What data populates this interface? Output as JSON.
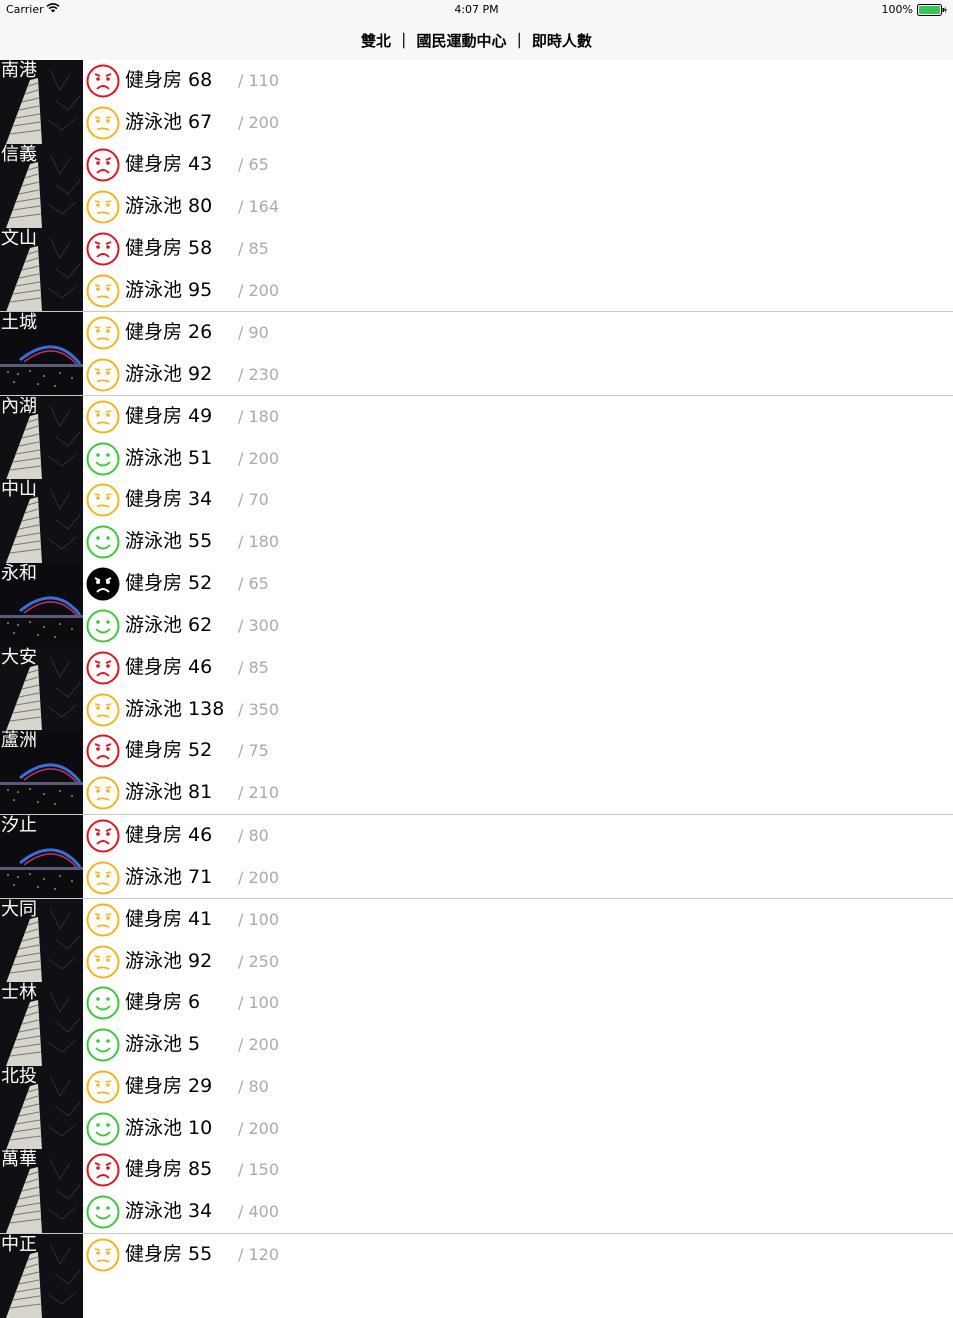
{
  "status_bar": {
    "carrier": "Carrier",
    "time": "4:07 PM",
    "battery": "100%"
  },
  "nav": {
    "title": "雙北 ｜ 國民運動中心 ｜ 即時人數"
  },
  "colors": {
    "crowded": "#e0141e",
    "moderate": "#f4b41a",
    "empty": "#3cc83c",
    "full": "#000000"
  },
  "centers": [
    {
      "name": "南港",
      "scene": "tower",
      "gym": {
        "label": "健身房 68",
        "capacity": "/ 110",
        "status": "crowded"
      },
      "pool": {
        "label": "游泳池 67",
        "capacity": "/ 200",
        "status": "moderate"
      }
    },
    {
      "name": "信義",
      "scene": "tower",
      "gym": {
        "label": "健身房 43",
        "capacity": "/ 65",
        "status": "crowded"
      },
      "pool": {
        "label": "游泳池 80",
        "capacity": "/ 164",
        "status": "moderate"
      }
    },
    {
      "name": "文山",
      "scene": "tower",
      "gym": {
        "label": "健身房 58",
        "capacity": "/ 85",
        "status": "crowded"
      },
      "pool": {
        "label": "游泳池 95",
        "capacity": "/ 200",
        "status": "moderate"
      }
    },
    {
      "name": "土城",
      "scene": "bridge",
      "gym": {
        "label": "健身房 26",
        "capacity": "/ 90",
        "status": "moderate"
      },
      "pool": {
        "label": "游泳池 92",
        "capacity": "/ 230",
        "status": "moderate"
      }
    },
    {
      "name": "內湖",
      "scene": "tower",
      "gym": {
        "label": "健身房 49",
        "capacity": "/ 180",
        "status": "moderate"
      },
      "pool": {
        "label": "游泳池 51",
        "capacity": "/ 200",
        "status": "empty"
      }
    },
    {
      "name": "中山",
      "scene": "tower",
      "gym": {
        "label": "健身房 34",
        "capacity": "/ 70",
        "status": "moderate"
      },
      "pool": {
        "label": "游泳池 55",
        "capacity": "/ 180",
        "status": "empty"
      }
    },
    {
      "name": "永和",
      "scene": "bridge",
      "gym": {
        "label": "健身房 52",
        "capacity": "/ 65",
        "status": "full"
      },
      "pool": {
        "label": "游泳池 62",
        "capacity": "/ 300",
        "status": "empty"
      }
    },
    {
      "name": "大安",
      "scene": "tower",
      "gym": {
        "label": "健身房 46",
        "capacity": "/ 85",
        "status": "crowded"
      },
      "pool": {
        "label": "游泳池 138",
        "capacity": "/ 350",
        "status": "moderate"
      }
    },
    {
      "name": "蘆洲",
      "scene": "bridge",
      "gym": {
        "label": "健身房 52",
        "capacity": "/ 75",
        "status": "crowded"
      },
      "pool": {
        "label": "游泳池 81",
        "capacity": "/ 210",
        "status": "moderate"
      }
    },
    {
      "name": "汐止",
      "scene": "bridge",
      "gym": {
        "label": "健身房 46",
        "capacity": "/ 80",
        "status": "crowded"
      },
      "pool": {
        "label": "游泳池 71",
        "capacity": "/ 200",
        "status": "moderate"
      }
    },
    {
      "name": "大同",
      "scene": "tower",
      "gym": {
        "label": "健身房 41",
        "capacity": "/ 100",
        "status": "moderate"
      },
      "pool": {
        "label": "游泳池 92",
        "capacity": "/ 250",
        "status": "moderate"
      }
    },
    {
      "name": "士林",
      "scene": "tower",
      "gym": {
        "label": "健身房 6",
        "capacity": "/ 100",
        "status": "empty"
      },
      "pool": {
        "label": "游泳池 5",
        "capacity": "/ 200",
        "status": "empty"
      }
    },
    {
      "name": "北投",
      "scene": "tower",
      "gym": {
        "label": "健身房 29",
        "capacity": "/ 80",
        "status": "moderate"
      },
      "pool": {
        "label": "游泳池 10",
        "capacity": "/ 200",
        "status": "empty"
      }
    },
    {
      "name": "萬華",
      "scene": "tower",
      "gym": {
        "label": "健身房 85",
        "capacity": "/ 150",
        "status": "crowded"
      },
      "pool": {
        "label": "游泳池 34",
        "capacity": "/ 400",
        "status": "empty"
      }
    },
    {
      "name": "中正",
      "scene": "tower",
      "gym": {
        "label": "健身房 55",
        "capacity": "/ 120",
        "status": "moderate"
      },
      "pool": null
    }
  ]
}
